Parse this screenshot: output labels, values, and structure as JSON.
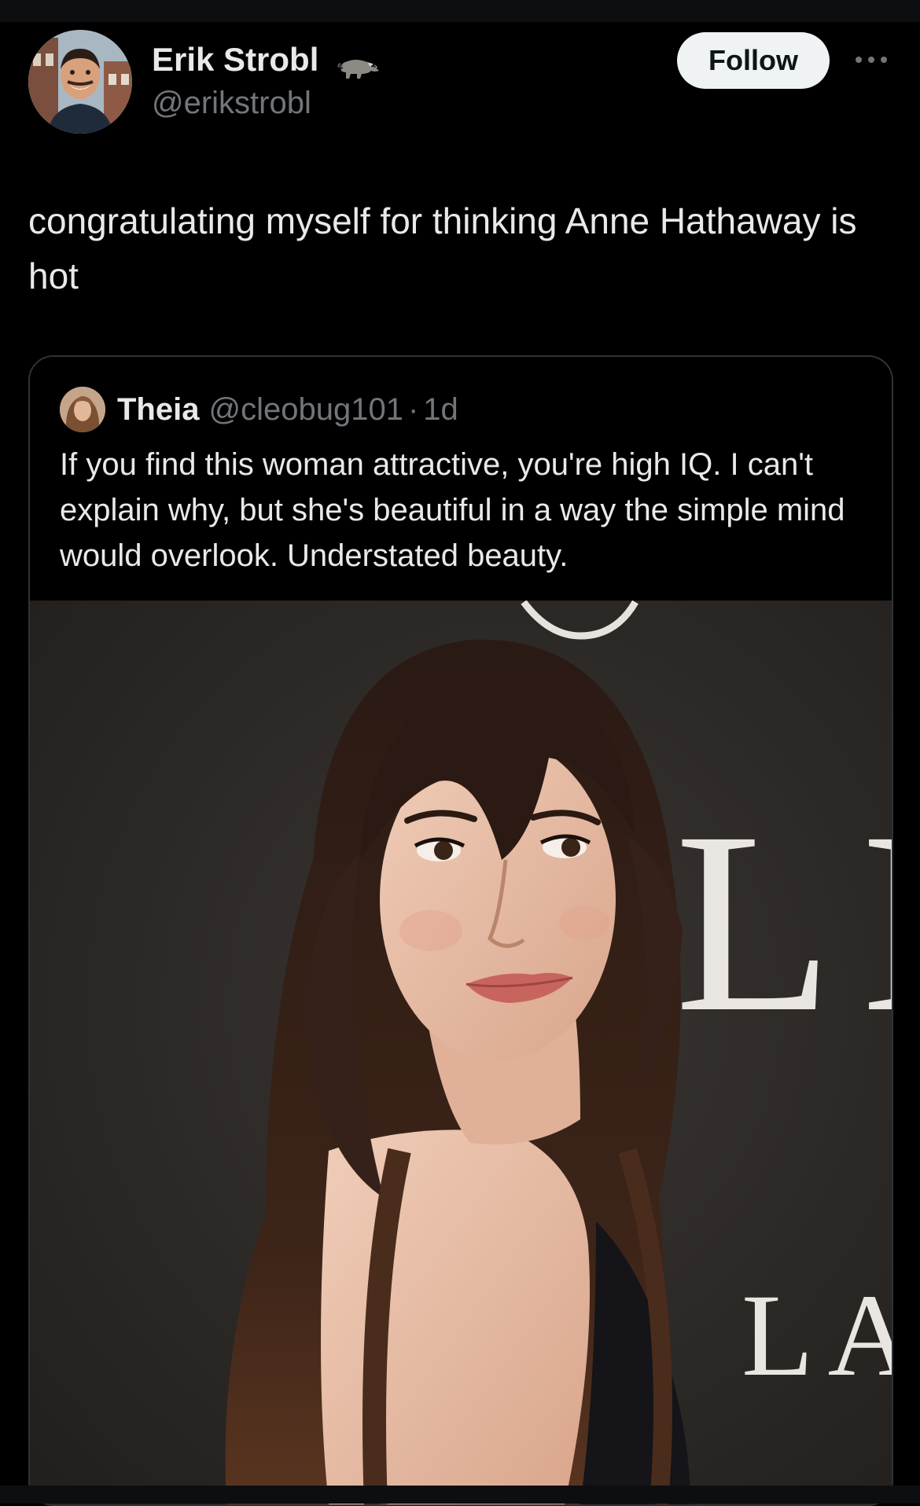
{
  "author": {
    "display_name": "Erik Strobl",
    "handle": "@erikstrobl",
    "badge_icon": "raccoon-icon"
  },
  "actions": {
    "follow_label": "Follow",
    "more_icon": "more-horizontal-icon"
  },
  "tweet": {
    "text": "congratulating myself for thinking Anne Hathaway is hot"
  },
  "quote": {
    "display_name": "Theia",
    "handle": "@cleobug101",
    "separator": "·",
    "time": "1d",
    "text": "If you find this woman attractive, you're high IQ. I can't explain why, but she's beautiful in a way the simple mind would overlook. Understated beauty.",
    "media": {
      "watermark_top": "LL",
      "watermark_bottom": "LA"
    }
  },
  "colors": {
    "background": "#000000",
    "text_primary": "#e7e9ea",
    "text_secondary": "#71767b",
    "border": "#2f3336",
    "follow_bg": "#eff3f4",
    "follow_text": "#0f1419"
  }
}
